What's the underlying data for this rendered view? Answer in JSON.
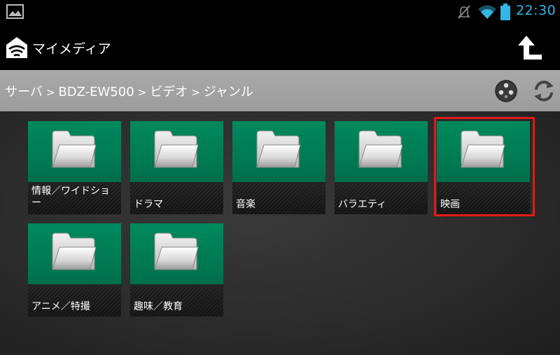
{
  "status_bar": {
    "time": "22:30",
    "icons": [
      "gallery-icon",
      "mute-icon",
      "wifi-icon",
      "battery-icon"
    ],
    "accent_color": "#33b5e5"
  },
  "action_bar": {
    "title": "マイメディア",
    "icons": [
      "app-logo-icon",
      "up-arrow-icon"
    ]
  },
  "breadcrumb": {
    "items": [
      "サーバ",
      "BDZ-EW500",
      "ビデオ",
      "ジャンル"
    ],
    "separator": ">",
    "icons": [
      "remote-icon",
      "refresh-icon"
    ]
  },
  "grid": {
    "tiles": [
      {
        "label": "情報／ワイドショー",
        "icon": "folder-icon"
      },
      {
        "label": "ドラマ",
        "icon": "folder-icon"
      },
      {
        "label": "音楽",
        "icon": "folder-icon"
      },
      {
        "label": "バラエティ",
        "icon": "folder-icon"
      },
      {
        "label": "映画",
        "icon": "folder-icon",
        "highlighted": true
      },
      {
        "label": "アニメ／特撮",
        "icon": "folder-icon"
      },
      {
        "label": "趣味／教育",
        "icon": "folder-icon"
      }
    ],
    "tile_color": "#007a52",
    "highlight_color": "#e01b1b"
  }
}
